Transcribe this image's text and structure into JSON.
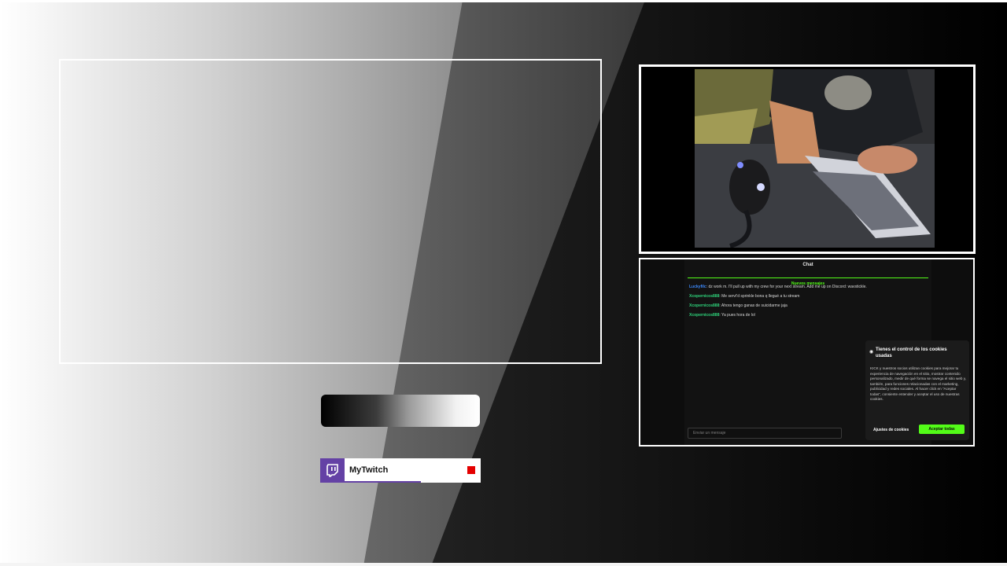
{
  "background": {
    "colors": {
      "light": "#ffffff",
      "mid": "#9a9a9a",
      "dark": "#1a1a1a",
      "black": "#000000"
    }
  },
  "chat": {
    "title": "Chat",
    "divider_label": "Nuevos mensajes",
    "messages": [
      {
        "user": "Luckyfilc",
        "user_color": "#3d8bff",
        "text": ": dz work m. I'll pull up with my crew for your next stream. Add me up on Discord: wavstickle."
      },
      {
        "user": "Xcopernicos888",
        "user_color": "#2ed27a",
        "text": ": Me serví'd sprinkle bona q llegué a tu stream"
      },
      {
        "user": "Xcopernicos888",
        "user_color": "#2ed27a",
        "text": ": Ahora tengo ganas de suicidarme jaja"
      },
      {
        "user": "Xcopernicos888",
        "user_color": "#2ed27a",
        "text": ": Ya pues hora de lol"
      }
    ],
    "input_placeholder": "Enviar un mensaje"
  },
  "cookie_banner": {
    "title": "Tienes el control de los cookies usadas",
    "body": "KICK y nuestros socios utilizan cookies para mejorar tu experiencia de navegación en el sitio, mostrar contenido personalizado, medir de qué forma se navega el sitio web y, también, para funciones relacionadas con el marketing, publicidad y redes sociales. Al hacer click en \"Aceptar todas\", consiente entender y aceptar el uso de nuestras cookies.",
    "settings_label": "Ajustes de cookies",
    "accept_label": "Aceptar todas",
    "accent_color": "#53fc18"
  },
  "twitch": {
    "name": "MyTwitch",
    "brand_color": "#6441a5",
    "icon": "twitch-icon",
    "live_indicator_color": "#e40000"
  },
  "webcam": {
    "icon": "webcam-feed"
  }
}
